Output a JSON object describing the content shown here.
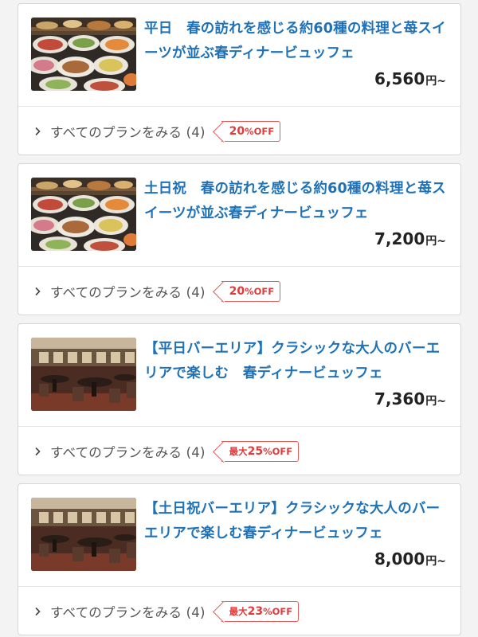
{
  "plans": [
    {
      "title": "平日　春の訪れを感じる約60種の料理と苺スイーツが並ぶ春ディナービュッフェ",
      "price": "6,560",
      "price_unit": "円~",
      "more_label": "すべてのプランをみる (4)",
      "badge_prefix": "",
      "badge_num": "20",
      "badge_pct": "%OFF",
      "image": "buffet-food-photo"
    },
    {
      "title": "土日祝　春の訪れを感じる約60種の料理と苺スイーツが並ぶ春ディナービュッフェ",
      "price": "7,200",
      "price_unit": "円~",
      "more_label": "すべてのプランをみる (4)",
      "badge_prefix": "",
      "badge_num": "20",
      "badge_pct": "%OFF",
      "image": "buffet-food-photo"
    },
    {
      "title": "【平日バーエリア】クラシックな大人のバーエリアで楽しむ　春ディナービュッフェ",
      "price": "7,360",
      "price_unit": "円~",
      "more_label": "すべてのプランをみる (4)",
      "badge_prefix": "最大",
      "badge_num": "25",
      "badge_pct": "%OFF",
      "image": "bar-area-photo"
    },
    {
      "title": "【土日祝バーエリア】クラシックな大人のバーエリアで楽しむ春ディナービュッフェ",
      "price": "8,000",
      "price_unit": "円~",
      "more_label": "すべてのプランをみる (4)",
      "badge_prefix": "最大",
      "badge_num": "23",
      "badge_pct": "%OFF",
      "image": "bar-area-photo"
    }
  ],
  "icons": {
    "expand": "chevron-right-icon"
  },
  "colors": {
    "title": "#1f72b8",
    "discount": "#e03b3b",
    "border": "#d6d6d6"
  }
}
